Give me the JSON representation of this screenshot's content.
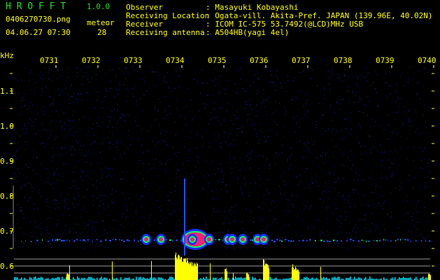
{
  "app": {
    "title": "H R O F F T",
    "version": "1.0.0"
  },
  "file": {
    "name": "0406270730.png",
    "datetime": "04.06.27 07:30"
  },
  "meteor": {
    "label": "meteor",
    "count": "28"
  },
  "info": [
    {
      "label": "Observer",
      "value": ": Masayuki Kobayashi"
    },
    {
      "label": "Receiving Location",
      "value": ": Ogata-vill. Akita-Pref. JAPAN (139.96E, 40.02N)"
    },
    {
      "label": "Receiver",
      "value": ": ICOM IC-575 53.7492(@LCD)MHz USB"
    },
    {
      "label": "Receiving antenna",
      "value": ": A504HB(yagi 4el)"
    }
  ],
  "axis": {
    "unit": "kHz",
    "y_ticks": [
      "1.1",
      "1.0",
      "0.9",
      "0.8",
      "0.7",
      "0.6"
    ],
    "x_ticks": [
      "0731",
      "0732",
      "0733",
      "0734",
      "0735",
      "0736",
      "0737",
      "0738",
      "0739",
      "0740"
    ]
  },
  "colors": {
    "background": "#000000",
    "text": "#ffff00",
    "title": "#22dd22",
    "noise": "#0a1a8a",
    "echo_strong": "#ff2070",
    "echo_mid": "#00ff60",
    "bar_high": "#ffff00",
    "bar_low": "#00e0ff"
  },
  "echoes_min": [
    3.1,
    3.45,
    4.05,
    4.2,
    4.6,
    5.05,
    5.15,
    5.4,
    5.75,
    5.9
  ]
}
